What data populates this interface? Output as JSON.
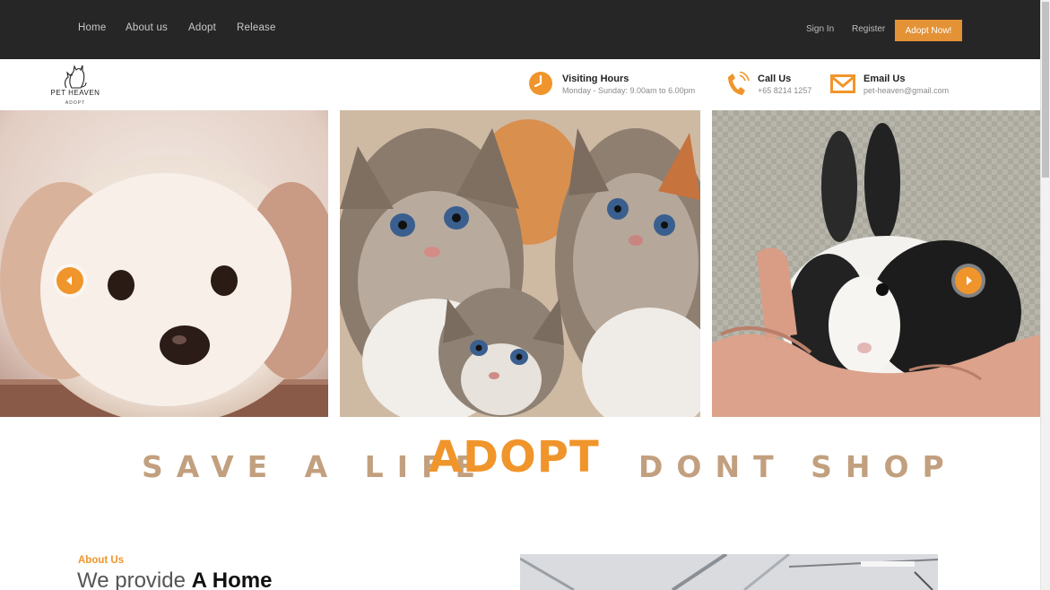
{
  "nav": {
    "links": [
      "Home",
      "About us",
      "Adopt",
      "Release"
    ],
    "sign_in": "Sign In",
    "register": "Register",
    "cta": "Adopt Now!"
  },
  "brand": {
    "name": "PET HEAVEN",
    "tagline": "ADOPT"
  },
  "contact": {
    "hours_title": "Visiting Hours",
    "hours_value": "Monday - Sunday: 9.00am to 6.00pm",
    "call_title": "Call Us",
    "call_value": "+65 8214 1257",
    "email_title": "Email Us",
    "email_value": "pet-heaven@gmail.com"
  },
  "slider": {
    "slides": [
      "puppy",
      "kittens",
      "rabbit"
    ]
  },
  "banner": {
    "left": "SAVE A LIFE",
    "center": "ADOPT",
    "right": "DONT SHOP"
  },
  "about": {
    "label": "About Us",
    "heading_light": "We provide",
    "heading_bold": "A Home"
  },
  "colors": {
    "accent": "#f0952b",
    "tan": "#c2a07f",
    "topbar": "#262626"
  }
}
